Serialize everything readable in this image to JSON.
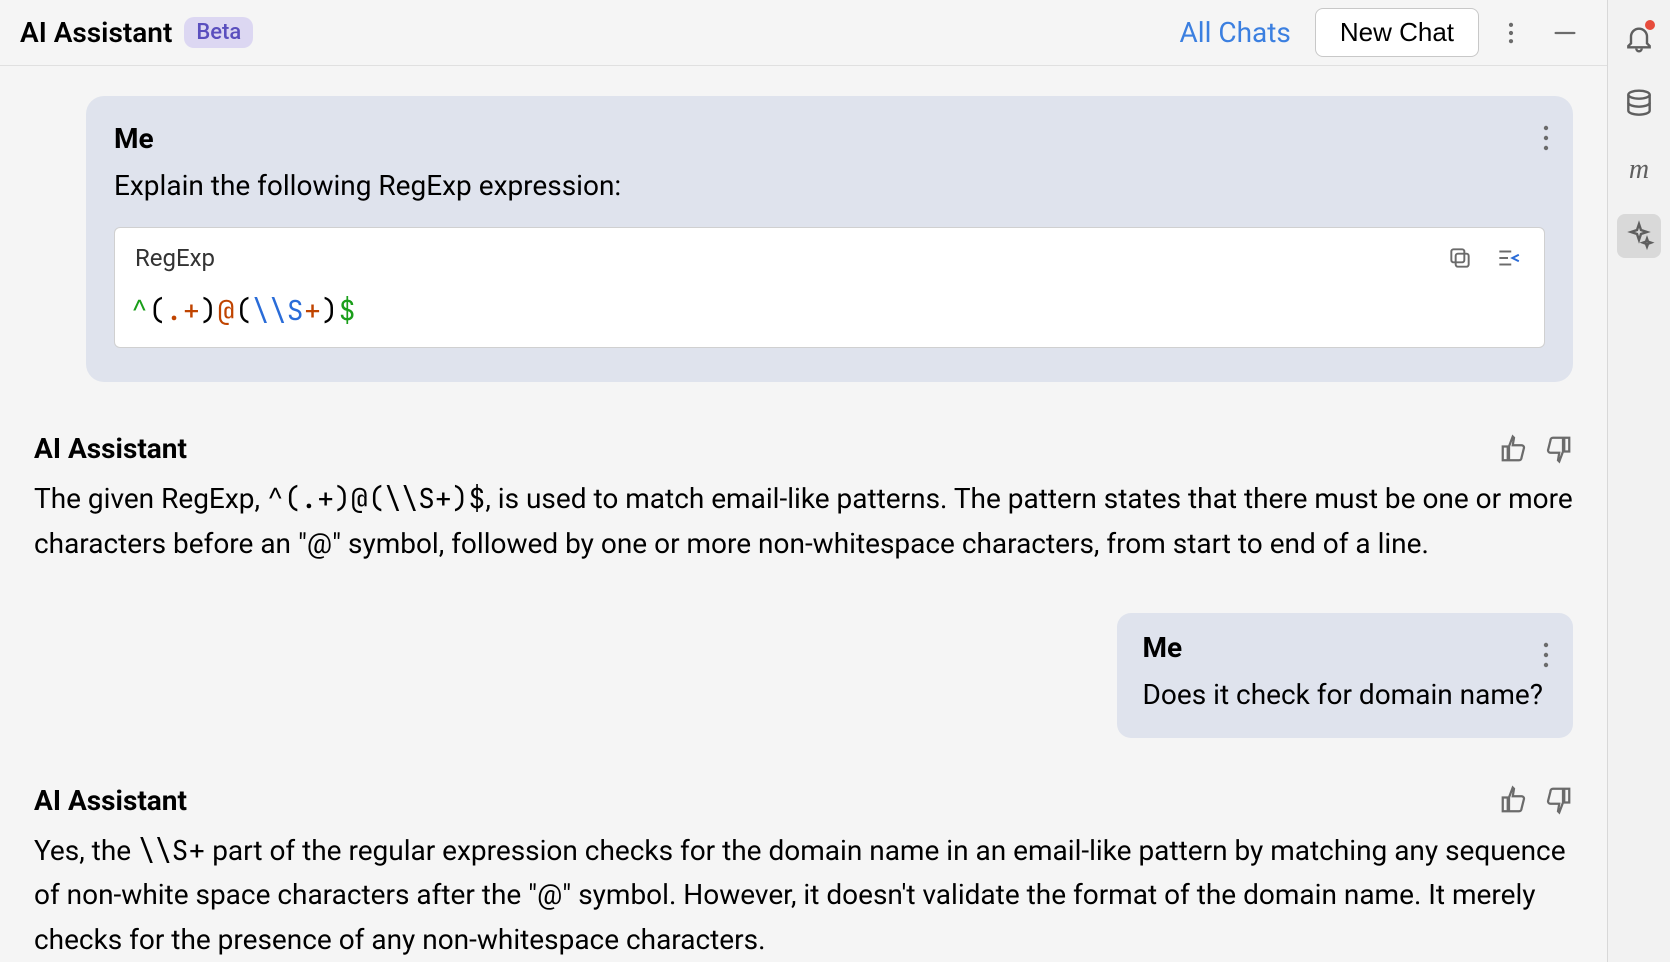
{
  "header": {
    "title": "AI Assistant",
    "badge": "Beta",
    "all_chats": "All Chats",
    "new_chat": "New Chat"
  },
  "messages": {
    "user1": {
      "sender": "Me",
      "text": "Explain the following RegExp expression:"
    },
    "code1": {
      "lang": "RegExp",
      "tok_caret": "^",
      "tok_group1_open": "(",
      "tok_dot": ".",
      "tok_plus1": "+",
      "tok_group1_close": ")",
      "tok_at": "@",
      "tok_group2_open": "(",
      "tok_esc": "\\\\S",
      "tok_plus2": "+",
      "tok_group2_close": ")",
      "tok_dollar": "$"
    },
    "ai1": {
      "sender": "AI Assistant",
      "text_a": "The given RegExp, ",
      "text_mono": "^(.+)@(\\\\S+)$",
      "text_b": ", is used to match email-like patterns. The pattern states that there must be one or more characters before an \"@\" symbol, followed by one or more non-whitespace characters, from start to end of a line."
    },
    "user2": {
      "sender": "Me",
      "text": "Does it check for domain name?"
    },
    "ai2": {
      "sender": "AI Assistant",
      "text_a": "Yes, the ",
      "text_mono": "\\\\S+",
      "text_b": " part of the regular expression checks for the domain name in an email-like pattern by matching any sequence of non-white space characters after the \"@\" symbol. However, it doesn't validate the format of the domain name. It merely checks for the presence of any non-whitespace characters."
    }
  },
  "rail": {
    "m_label": "m"
  }
}
